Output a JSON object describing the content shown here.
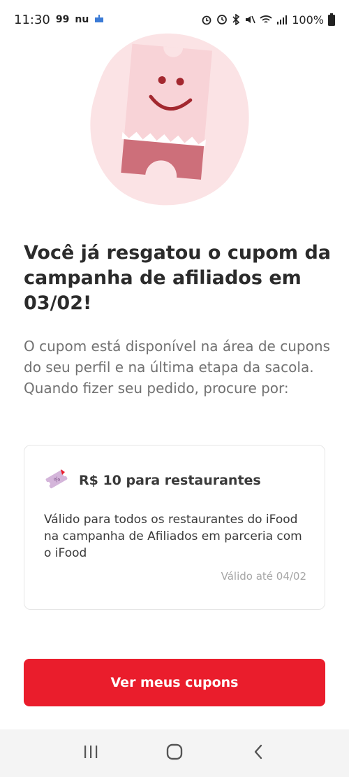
{
  "status_bar": {
    "time": "11:30",
    "app_99": "99",
    "app_nu": "nu",
    "battery": "100%"
  },
  "main": {
    "title": "Você já resgatou o cupom da campanha de afiliados em 03/02!",
    "description": "O cupom está disponível na área de cupons do seu perfil e na última etapa da sacola. Quando fizer seu pedido, procure por:"
  },
  "coupon": {
    "title": "R$ 10 para restaurantes",
    "body": "Válido para todos os restaurantes do iFood na campanha de Afiliados em parceria com o iFood",
    "validity": "Válido até 04/02"
  },
  "actions": {
    "primary_label": "Ver meus cupons"
  },
  "colors": {
    "accent": "#ea1d2c",
    "ticket_pink": "#f8d3d7",
    "ticket_dark": "#cd6f7a"
  },
  "icons": {
    "coupon": "coupon-ticket-icon",
    "nav_recents": "recents-icon",
    "nav_home": "home-icon",
    "nav_back": "back-icon"
  }
}
